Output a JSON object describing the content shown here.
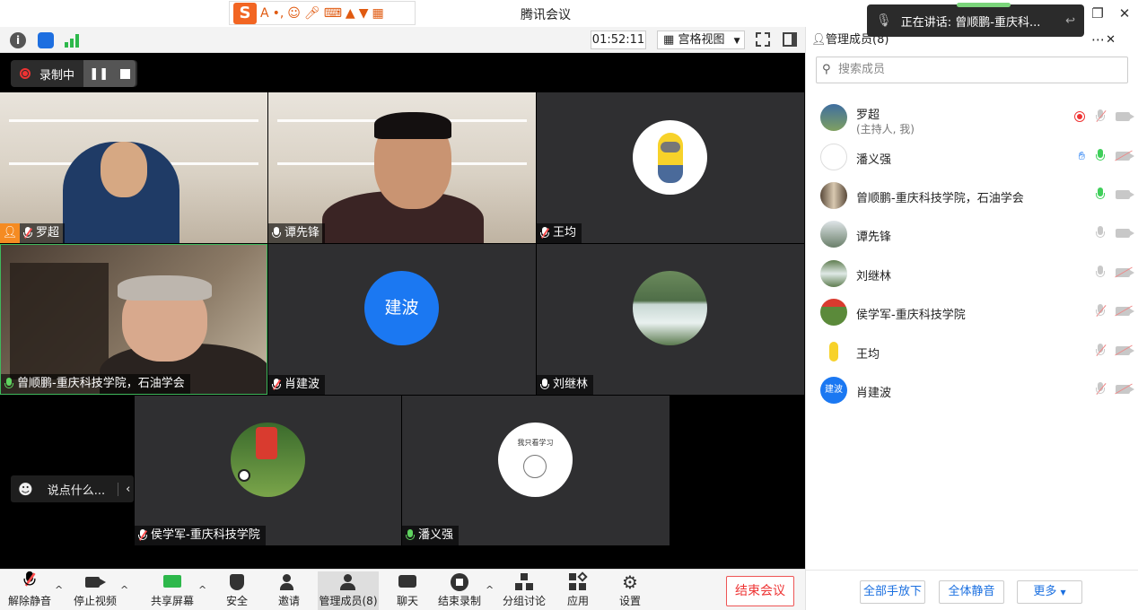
{
  "title_bar": {
    "app_title": "腾讯会议"
  },
  "speaking": {
    "label": "正在讲话: 曾顺鹏-重庆科..."
  },
  "toolbar": {
    "timer": "01:52:11",
    "view_label": "宫格视图"
  },
  "recording": {
    "label": "录制中"
  },
  "tiles": [
    {
      "name": "罗超",
      "mic": "off",
      "host": true
    },
    {
      "name": "谭先锋",
      "mic": "on-white"
    },
    {
      "name": "王均",
      "mic": "off"
    },
    {
      "name": "曾顺鹏-重庆科技学院，石油学会",
      "mic": "on"
    },
    {
      "name": "肖建波",
      "mic": "off",
      "avatar_text": "建波"
    },
    {
      "name": "刘继林",
      "mic": "on-white"
    },
    {
      "name": "侯学军-重庆科技学院",
      "mic": "off"
    },
    {
      "name": "潘义强",
      "mic": "on"
    }
  ],
  "tile_sticker_text": "我只看学习",
  "chat": {
    "placeholder": "说点什么..."
  },
  "bottom_bar": {
    "unmute": "解除静音",
    "stop_video": "停止视频",
    "share": "共享屏幕",
    "security": "安全",
    "invite": "邀请",
    "manage": "管理成员(8)",
    "chat": "聊天",
    "stop_record": "结束录制",
    "breakout": "分组讨论",
    "apps": "应用",
    "settings": "设置",
    "end": "结束会议"
  },
  "panel": {
    "title": "管理成员(8)",
    "search_placeholder": "搜索成员",
    "members": [
      {
        "name": "罗超",
        "sub": "(主持人, 我)",
        "mic": "off",
        "cam": "on",
        "rec": true
      },
      {
        "name": "潘义强",
        "mic": "green",
        "cam": "off",
        "hand": true
      },
      {
        "name": "曾顺鹏-重庆科技学院，石油学会",
        "mic": "green",
        "cam": "on"
      },
      {
        "name": "谭先锋",
        "mic": "grey",
        "cam": "on"
      },
      {
        "name": "刘继林",
        "mic": "grey",
        "cam": "off"
      },
      {
        "name": "侯学军-重庆科技学院",
        "mic": "off",
        "cam": "off"
      },
      {
        "name": "王均",
        "mic": "off",
        "cam": "off"
      },
      {
        "name": "肖建波",
        "mic": "off",
        "cam": "off",
        "avatar_text": "建波"
      }
    ],
    "footer": {
      "lower_hands": "全部手放下",
      "mute_all": "全体静音",
      "more": "更多"
    }
  }
}
